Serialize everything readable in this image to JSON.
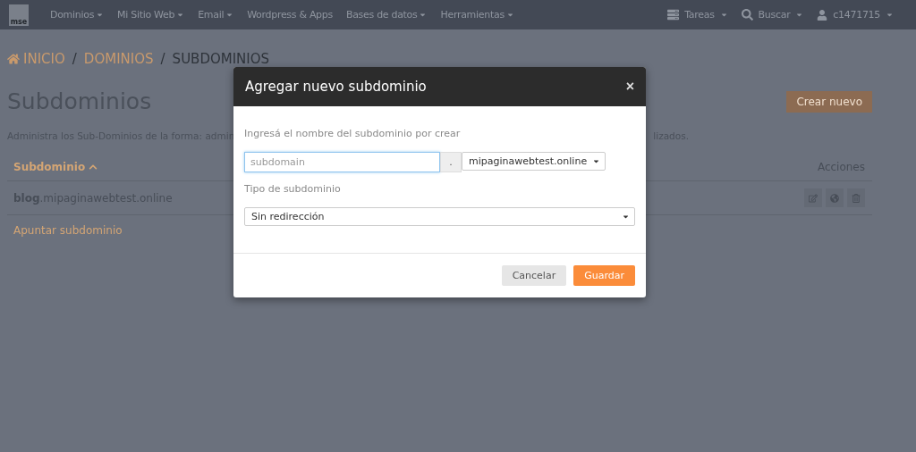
{
  "navbar": {
    "logo_text": "mse",
    "menu": [
      {
        "label": "Dominios",
        "dropdown": true
      },
      {
        "label": "Mi Sitio Web",
        "dropdown": true
      },
      {
        "label": "Email",
        "dropdown": true
      },
      {
        "label": "Wordpress & Apps",
        "dropdown": false
      },
      {
        "label": "Bases de datos",
        "dropdown": true
      },
      {
        "label": "Herramientas",
        "dropdown": true
      }
    ],
    "right": [
      {
        "kind": "tasks",
        "label": "Tareas"
      },
      {
        "kind": "search",
        "label": "Buscar"
      },
      {
        "kind": "user",
        "label": "c1471715"
      }
    ]
  },
  "breadcrumb": [
    {
      "label": "INICIO",
      "kind": "home"
    },
    {
      "separator": "/",
      "label": "DOMINIOS",
      "kind": "link"
    },
    {
      "separator": "/",
      "label": "SUBDOMINIOS",
      "kind": "current"
    }
  ],
  "page": {
    "title": "Subdominios",
    "create_button": "Crear nuevo",
    "description_start": "Administra los Sub-Dominios de la forma: admin",
    "description_end": "lizados."
  },
  "table": {
    "columns": [
      "Subdominio",
      "Acciones"
    ],
    "rows": [
      {
        "subdomain": "**blog**.mipaginawebtest.online"
      }
    ],
    "link": "Apuntar subdominio"
  },
  "modal": {
    "title": "Agregar nuevo subdominio",
    "close": "×",
    "name_label": "Ingresá el nombre del subdominio por crear",
    "name_placeholder": "subdomain",
    "separator": ".",
    "domain": "mipaginawebtest.online",
    "type_label": "Tipo de subdominio",
    "type_value": "Sin redirección",
    "buttons": [
      {
        "label": "Cancelar",
        "kind": "secondary"
      },
      {
        "label": "Guardar",
        "kind": "primary"
      }
    ]
  }
}
